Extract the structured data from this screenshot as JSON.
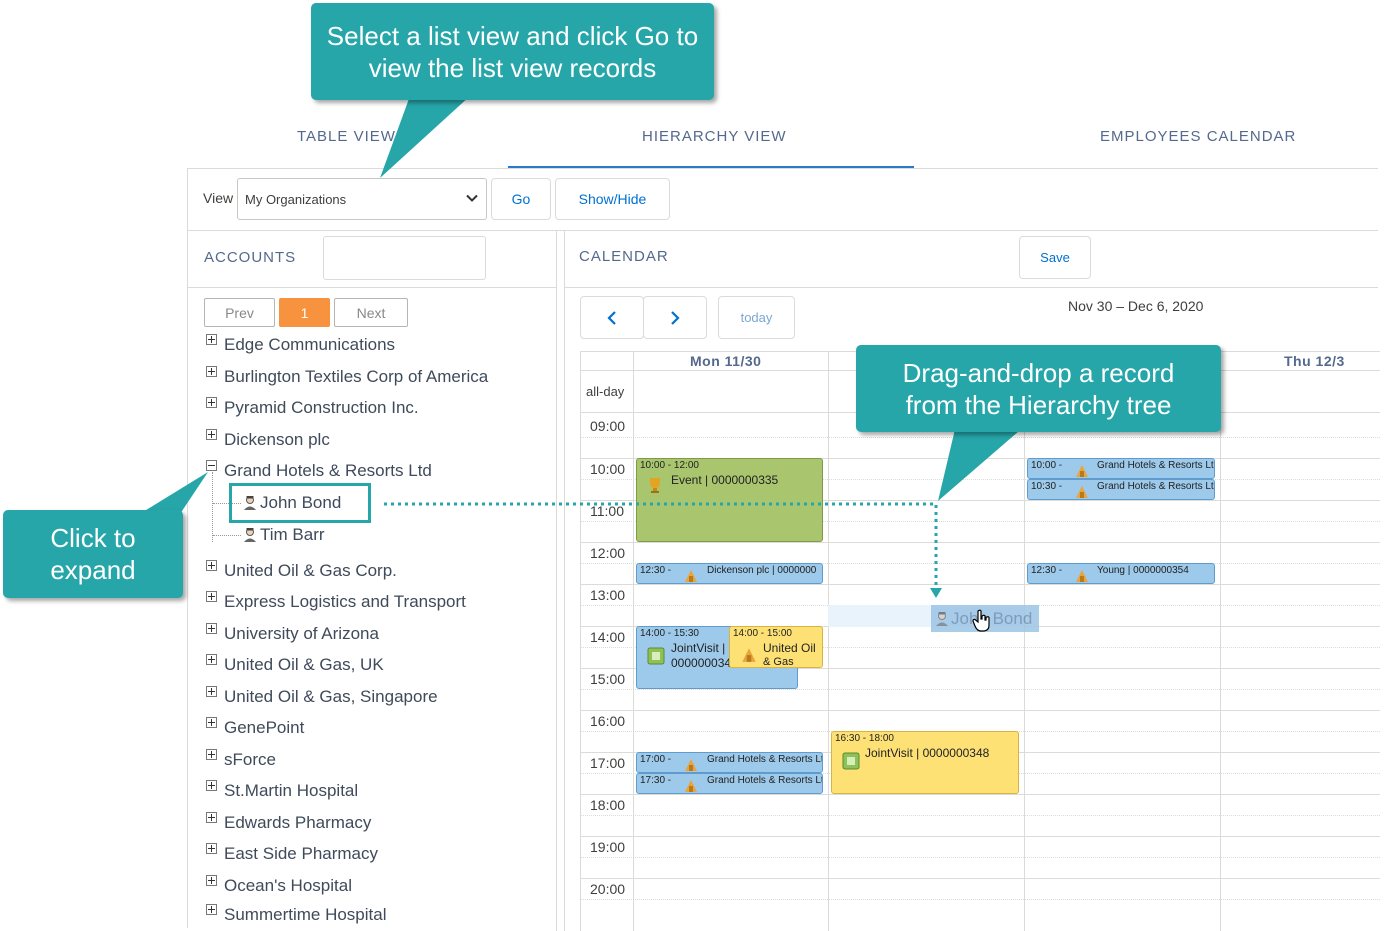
{
  "tabs": {
    "table_view": "TABLE VIEW",
    "hierarchy_view": "HIERARCHY VIEW",
    "employees_calendar": "EMPLOYEES CALENDAR"
  },
  "toolbar": {
    "view_label": "View",
    "view_selected": "My Organizations",
    "go_label": "Go",
    "showhide_label": "Show/Hide"
  },
  "accounts": {
    "header": "ACCOUNTS",
    "search_value": "",
    "pager": {
      "prev": "Prev",
      "current": "1",
      "next": "Next"
    },
    "items": [
      "Edge Communications",
      "Burlington Textiles Corp of America",
      "Pyramid Construction Inc.",
      "Dickenson plc",
      "Grand Hotels & Resorts Ltd",
      "United Oil & Gas Corp.",
      "Express Logistics and Transport",
      "University of Arizona",
      "United Oil & Gas, UK",
      "United Oil & Gas, Singapore",
      "GenePoint",
      "sForce",
      "St.Martin Hospital",
      "Edwards Pharmacy",
      "East Side Pharmacy",
      "Ocean's Hospital",
      "Summertime Hospital"
    ],
    "children": [
      "John Bond",
      "Tim Barr"
    ]
  },
  "calendar": {
    "header": "CALENDAR",
    "save_label": "Save",
    "today_label": "today",
    "date_range": "Nov 30 – Dec 6, 2020",
    "days": [
      "Mon 11/30",
      "Thu 12/3"
    ],
    "allday": "all-day",
    "times": [
      "09:00",
      "10:00",
      "11:00",
      "12:00",
      "13:00",
      "14:00",
      "15:00",
      "16:00",
      "17:00",
      "18:00",
      "19:00",
      "20:00"
    ],
    "events": {
      "e1_time": "10:00 - 12:00",
      "e1_text": "Event | 0000000335",
      "e2_time": "12:30 -",
      "e2_text": "Dickenson plc | 0000000",
      "e3_time": "14:00 - 15:30",
      "e3_text1": "JointVisit |",
      "e3_text2": "000000034",
      "e4_time": "14:00 - 15:00",
      "e4_text1": "United Oil",
      "e4_text2": "& Gas",
      "e5_time": "17:00 -",
      "e5_text": "Grand Hotels & Resorts Lt",
      "e6_time": "17:30 -",
      "e6_text": "Grand Hotels & Resorts Lt",
      "e7_time": "16:30 - 18:00",
      "e7_text": "JointVisit | 0000000348",
      "e8_time": "10:00 -",
      "e8_text": "Grand Hotels & Resorts Lt",
      "e9_time": "10:30 -",
      "e9_text": "Grand Hotels & Resorts Lt",
      "e10_time": "12:30 -",
      "e10_text": "Young | 0000000354"
    },
    "drag_label": "John Bond"
  },
  "callouts": {
    "top": "Select a list view and click Go to view the list view records",
    "left": "Click to expand",
    "right": "Drag-and-drop a record from the Hierarchy tree"
  },
  "colors": {
    "callout": "#26a6a9",
    "accent": "#0070d2",
    "pager_active": "#f7923e"
  }
}
